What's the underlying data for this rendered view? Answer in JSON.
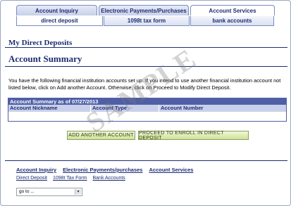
{
  "tabs_primary": [
    {
      "label": "Account Inquiry",
      "active": false
    },
    {
      "label": "Electronic Payments/Purchases",
      "active": false
    },
    {
      "label": "Account Services",
      "active": true
    }
  ],
  "tabs_secondary": [
    {
      "label": "direct deposit",
      "active": true
    },
    {
      "label": "1098t tax form",
      "active": false
    },
    {
      "label": "bank accounts",
      "active": false
    }
  ],
  "page_title": "My Direct Deposits",
  "section_title": "Account Summary",
  "intro_text": "You have the following financial institution accounts set up.  If you intend to use another financial institution account not listed below, click on Add another Account.  Otherwise, click on Proceed to Modify Direct Deposit.",
  "grid": {
    "title": "Account Summary as of 07/27/2013",
    "columns": [
      "Account Nickname",
      "Account Type",
      "Account Number"
    ]
  },
  "buttons": {
    "add_account": "ADD ANOTHER ACCOUNT",
    "proceed": "PROCEED TO ENROLL IN DIRECT DEPOSIT"
  },
  "watermark": "SAMPLE",
  "footer_links_primary": [
    "Account Inquiry",
    "Electronic Payments/purchases",
    "Account Services"
  ],
  "footer_links_secondary": [
    "Direct Deposit",
    "1098t Tax Form",
    "Bank Accounts"
  ],
  "goto_select": {
    "value": "go to ..."
  },
  "colors": {
    "navy": "#1d2d72",
    "grid_header": "#4f5fa6",
    "button_green": "#cfe19a"
  }
}
